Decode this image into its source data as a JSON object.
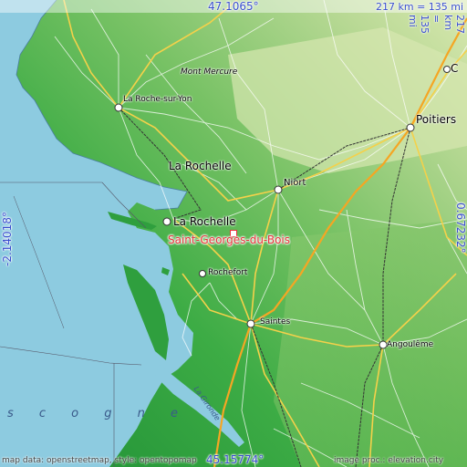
{
  "places": {
    "mont_mercure": "Mont Mercure",
    "la_roche_sur_yon": "La Roche-sur-Yon",
    "poitiers": "Poitiers",
    "la_rochelle_region": "La Rochelle",
    "niort": "Niort",
    "la_rochelle": "La Rochelle",
    "rochefort": "Rochefort",
    "saintes": "Saintes",
    "angouleme": "Angoulême",
    "city_c": "C"
  },
  "highlight": "Saint-Georges-du-Bois",
  "sea_label": "s c o g n e",
  "river_label": "La Gironde",
  "coords": {
    "top": "47.1065°",
    "bottom": "45.15774°",
    "left": "-2.14018°",
    "right": "0.67232°"
  },
  "scales": {
    "horizontal": "217 km = 135 mi",
    "vertical": "217 km = 135 mi"
  },
  "footer": {
    "left": "map data: openstreetmap, style: opentopomap",
    "right": "image proc.: elevation.city"
  },
  "colors": {
    "sea": "#8dcbe0",
    "lowland": "#33a641",
    "highland": "#cfe2a5",
    "highlight": "#e8333b",
    "coord_text": "#3a4fcf"
  }
}
